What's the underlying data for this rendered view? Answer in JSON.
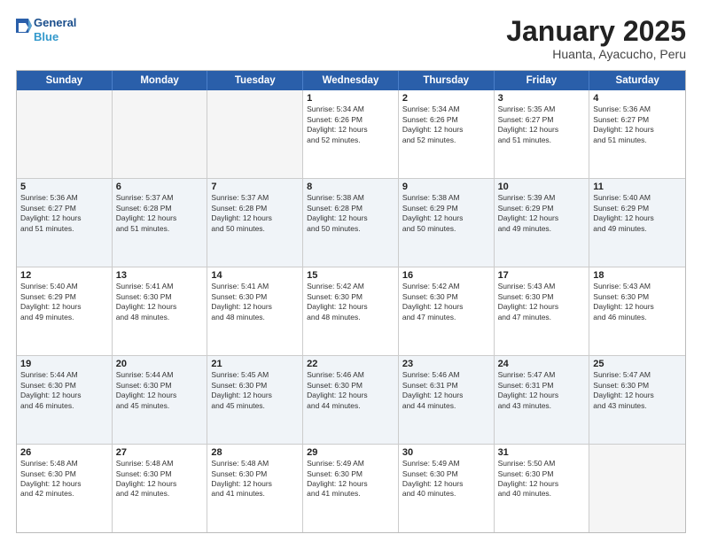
{
  "header": {
    "logo_line1": "General",
    "logo_line2": "Blue",
    "month": "January 2025",
    "location": "Huanta, Ayacucho, Peru"
  },
  "weekdays": [
    "Sunday",
    "Monday",
    "Tuesday",
    "Wednesday",
    "Thursday",
    "Friday",
    "Saturday"
  ],
  "rows": [
    {
      "alt": false,
      "cells": [
        {
          "num": "",
          "info": ""
        },
        {
          "num": "",
          "info": ""
        },
        {
          "num": "",
          "info": ""
        },
        {
          "num": "1",
          "info": "Sunrise: 5:34 AM\nSunset: 6:26 PM\nDaylight: 12 hours\nand 52 minutes."
        },
        {
          "num": "2",
          "info": "Sunrise: 5:34 AM\nSunset: 6:26 PM\nDaylight: 12 hours\nand 52 minutes."
        },
        {
          "num": "3",
          "info": "Sunrise: 5:35 AM\nSunset: 6:27 PM\nDaylight: 12 hours\nand 51 minutes."
        },
        {
          "num": "4",
          "info": "Sunrise: 5:36 AM\nSunset: 6:27 PM\nDaylight: 12 hours\nand 51 minutes."
        }
      ]
    },
    {
      "alt": true,
      "cells": [
        {
          "num": "5",
          "info": "Sunrise: 5:36 AM\nSunset: 6:27 PM\nDaylight: 12 hours\nand 51 minutes."
        },
        {
          "num": "6",
          "info": "Sunrise: 5:37 AM\nSunset: 6:28 PM\nDaylight: 12 hours\nand 51 minutes."
        },
        {
          "num": "7",
          "info": "Sunrise: 5:37 AM\nSunset: 6:28 PM\nDaylight: 12 hours\nand 50 minutes."
        },
        {
          "num": "8",
          "info": "Sunrise: 5:38 AM\nSunset: 6:28 PM\nDaylight: 12 hours\nand 50 minutes."
        },
        {
          "num": "9",
          "info": "Sunrise: 5:38 AM\nSunset: 6:29 PM\nDaylight: 12 hours\nand 50 minutes."
        },
        {
          "num": "10",
          "info": "Sunrise: 5:39 AM\nSunset: 6:29 PM\nDaylight: 12 hours\nand 49 minutes."
        },
        {
          "num": "11",
          "info": "Sunrise: 5:40 AM\nSunset: 6:29 PM\nDaylight: 12 hours\nand 49 minutes."
        }
      ]
    },
    {
      "alt": false,
      "cells": [
        {
          "num": "12",
          "info": "Sunrise: 5:40 AM\nSunset: 6:29 PM\nDaylight: 12 hours\nand 49 minutes."
        },
        {
          "num": "13",
          "info": "Sunrise: 5:41 AM\nSunset: 6:30 PM\nDaylight: 12 hours\nand 48 minutes."
        },
        {
          "num": "14",
          "info": "Sunrise: 5:41 AM\nSunset: 6:30 PM\nDaylight: 12 hours\nand 48 minutes."
        },
        {
          "num": "15",
          "info": "Sunrise: 5:42 AM\nSunset: 6:30 PM\nDaylight: 12 hours\nand 48 minutes."
        },
        {
          "num": "16",
          "info": "Sunrise: 5:42 AM\nSunset: 6:30 PM\nDaylight: 12 hours\nand 47 minutes."
        },
        {
          "num": "17",
          "info": "Sunrise: 5:43 AM\nSunset: 6:30 PM\nDaylight: 12 hours\nand 47 minutes."
        },
        {
          "num": "18",
          "info": "Sunrise: 5:43 AM\nSunset: 6:30 PM\nDaylight: 12 hours\nand 46 minutes."
        }
      ]
    },
    {
      "alt": true,
      "cells": [
        {
          "num": "19",
          "info": "Sunrise: 5:44 AM\nSunset: 6:30 PM\nDaylight: 12 hours\nand 46 minutes."
        },
        {
          "num": "20",
          "info": "Sunrise: 5:44 AM\nSunset: 6:30 PM\nDaylight: 12 hours\nand 45 minutes."
        },
        {
          "num": "21",
          "info": "Sunrise: 5:45 AM\nSunset: 6:30 PM\nDaylight: 12 hours\nand 45 minutes."
        },
        {
          "num": "22",
          "info": "Sunrise: 5:46 AM\nSunset: 6:30 PM\nDaylight: 12 hours\nand 44 minutes."
        },
        {
          "num": "23",
          "info": "Sunrise: 5:46 AM\nSunset: 6:31 PM\nDaylight: 12 hours\nand 44 minutes."
        },
        {
          "num": "24",
          "info": "Sunrise: 5:47 AM\nSunset: 6:31 PM\nDaylight: 12 hours\nand 43 minutes."
        },
        {
          "num": "25",
          "info": "Sunrise: 5:47 AM\nSunset: 6:30 PM\nDaylight: 12 hours\nand 43 minutes."
        }
      ]
    },
    {
      "alt": false,
      "cells": [
        {
          "num": "26",
          "info": "Sunrise: 5:48 AM\nSunset: 6:30 PM\nDaylight: 12 hours\nand 42 minutes."
        },
        {
          "num": "27",
          "info": "Sunrise: 5:48 AM\nSunset: 6:30 PM\nDaylight: 12 hours\nand 42 minutes."
        },
        {
          "num": "28",
          "info": "Sunrise: 5:48 AM\nSunset: 6:30 PM\nDaylight: 12 hours\nand 41 minutes."
        },
        {
          "num": "29",
          "info": "Sunrise: 5:49 AM\nSunset: 6:30 PM\nDaylight: 12 hours\nand 41 minutes."
        },
        {
          "num": "30",
          "info": "Sunrise: 5:49 AM\nSunset: 6:30 PM\nDaylight: 12 hours\nand 40 minutes."
        },
        {
          "num": "31",
          "info": "Sunrise: 5:50 AM\nSunset: 6:30 PM\nDaylight: 12 hours\nand 40 minutes."
        },
        {
          "num": "",
          "info": ""
        }
      ]
    }
  ]
}
